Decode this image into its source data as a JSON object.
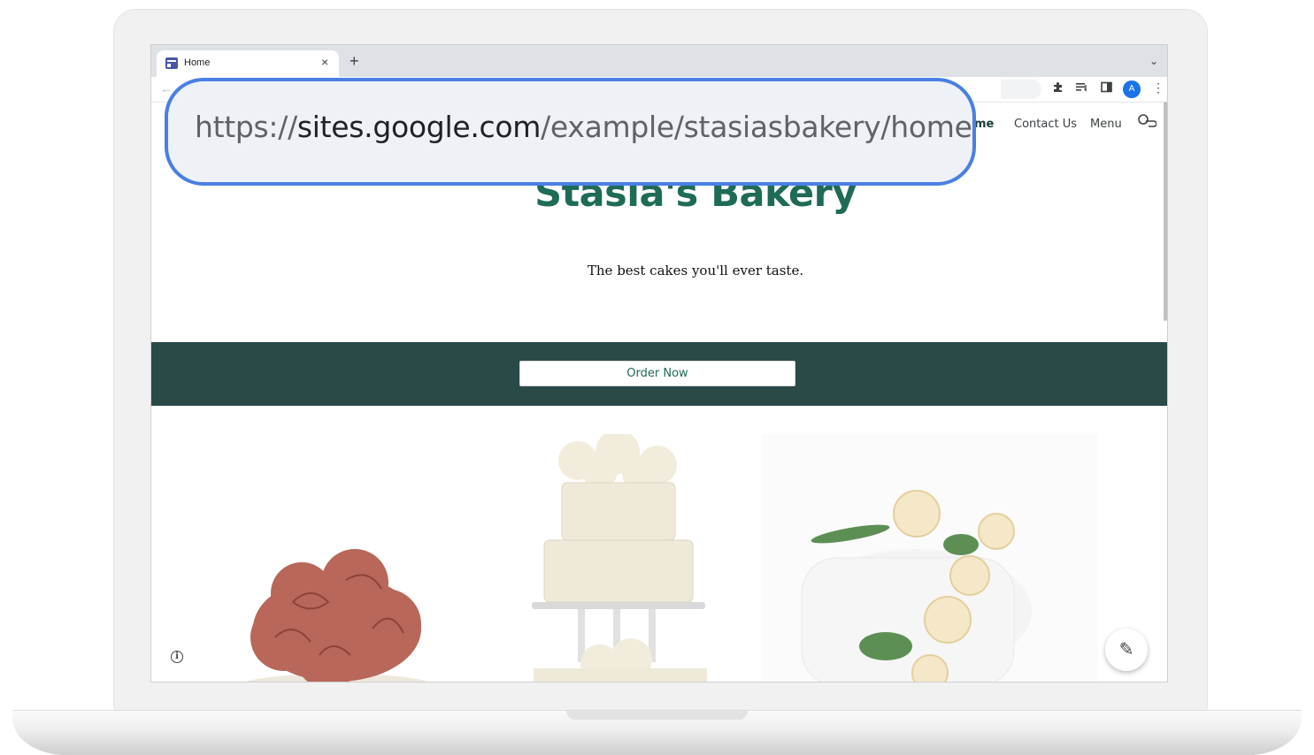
{
  "browser": {
    "tab_title": "Home",
    "tab_close": "×",
    "new_tab": "+",
    "tabs_menu": "⌄",
    "back": "←",
    "profile_initial": "A",
    "menu": "⋮"
  },
  "url": {
    "scheme": "https://",
    "host": "sites.google.com",
    "path": "/example/stasiasbakery/home"
  },
  "site": {
    "nav": {
      "home": "me",
      "contact": "Contact Us",
      "menu": "Menu"
    },
    "title": "Stasia's Bakery",
    "tagline": "The best cakes you'll ever taste.",
    "cta_label": "Order Now",
    "info": "i",
    "edit": "✎"
  },
  "colors": {
    "brand_green": "#1e6b57",
    "band": "#2a4a48",
    "callout_border": "#4a7fe3"
  }
}
